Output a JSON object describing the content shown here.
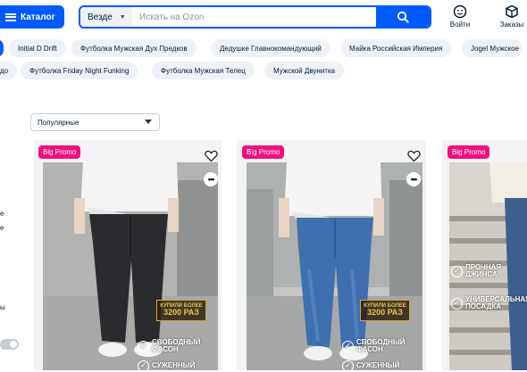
{
  "header": {
    "catalog_label": "Каталог",
    "search_scope": "Везде",
    "search_placeholder": "Искать на Ozon",
    "login_label": "Войти",
    "orders_label": "Заказы"
  },
  "chips_row1": [
    "Initial D Drift",
    "Футболка Мужская Дух Предков",
    "Дедушке Главнокомандующий",
    "Майка Российская Империя",
    "Jogel Мужское"
  ],
  "chips_row2": [
    "до",
    "Футболка Friday Night Funking",
    "Футболка Мужская Телец",
    "Мужской Двунитка"
  ],
  "sort": {
    "selected": "Популярные"
  },
  "left_fragments": [
    "е",
    "е",
    "ы"
  ],
  "products": [
    {
      "badge": "Big Promo",
      "sticker_top": "КУПИЛИ БОЛЕЕ",
      "sticker_bottom": "3200 РАЗ",
      "features": [
        "СВОБОДНЫЙ ФАСОН",
        "СУЖЕННЫЙ"
      ],
      "jeans_color": "#2a2b2e"
    },
    {
      "badge": "Big Promo",
      "sticker_top": "КУПИЛИ БОЛЕЕ",
      "sticker_bottom": "3200 РАЗ",
      "features": [
        "СВОБОДНЫЙ ФАСОН",
        "СУЖЕННЫЙ"
      ],
      "jeans_color": "#3f6fae"
    },
    {
      "badge": "Big Promo",
      "features": [
        "ПРОЧНАЯ ДЖИНСА",
        "УНИВЕРСАЛЬНАЯ ПОСАДКА"
      ],
      "jeans_color": "#3d5f8e"
    }
  ],
  "colors": {
    "accent": "#005bff",
    "promo": "#f1117e"
  }
}
